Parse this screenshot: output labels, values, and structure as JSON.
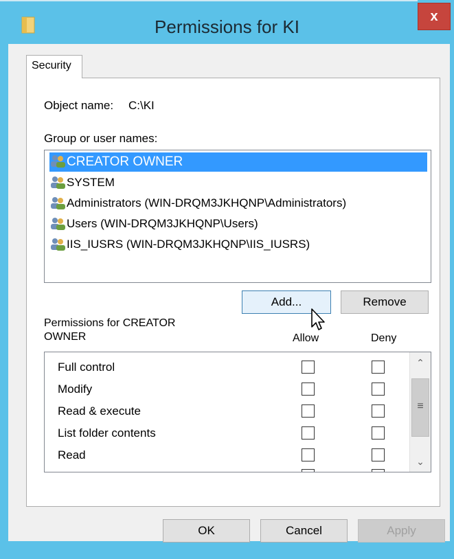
{
  "window": {
    "title": "Permissions for KI",
    "close_label": "x"
  },
  "tabs": [
    {
      "label": "Security"
    }
  ],
  "object": {
    "label": "Object name:",
    "value": "C:\\KI"
  },
  "groups": {
    "label": "Group or user names:",
    "items": [
      {
        "label": "CREATOR OWNER",
        "selected": true
      },
      {
        "label": "SYSTEM",
        "selected": false
      },
      {
        "label": "Administrators (WIN-DRQM3JKHQNP\\Administrators)",
        "selected": false
      },
      {
        "label": "Users (WIN-DRQM3JKHQNP\\Users)",
        "selected": false
      },
      {
        "label": "IIS_IUSRS (WIN-DRQM3JKHQNP\\IIS_IUSRS)",
        "selected": false
      }
    ],
    "add_label": "Add...",
    "remove_label": "Remove"
  },
  "permissions": {
    "label_line1": "Permissions for CREATOR",
    "label_line2": "OWNER",
    "allow_header": "Allow",
    "deny_header": "Deny",
    "rows": [
      {
        "label": "Full control",
        "allow": false,
        "deny": false
      },
      {
        "label": "Modify",
        "allow": false,
        "deny": false
      },
      {
        "label": "Read & execute",
        "allow": false,
        "deny": false
      },
      {
        "label": "List folder contents",
        "allow": false,
        "deny": false
      },
      {
        "label": "Read",
        "allow": false,
        "deny": false
      }
    ]
  },
  "footer": {
    "ok_label": "OK",
    "cancel_label": "Cancel",
    "apply_label": "Apply"
  },
  "colors": {
    "titlebar": "#5bc1e8",
    "selection": "#3399ff",
    "close": "#c6453d"
  }
}
